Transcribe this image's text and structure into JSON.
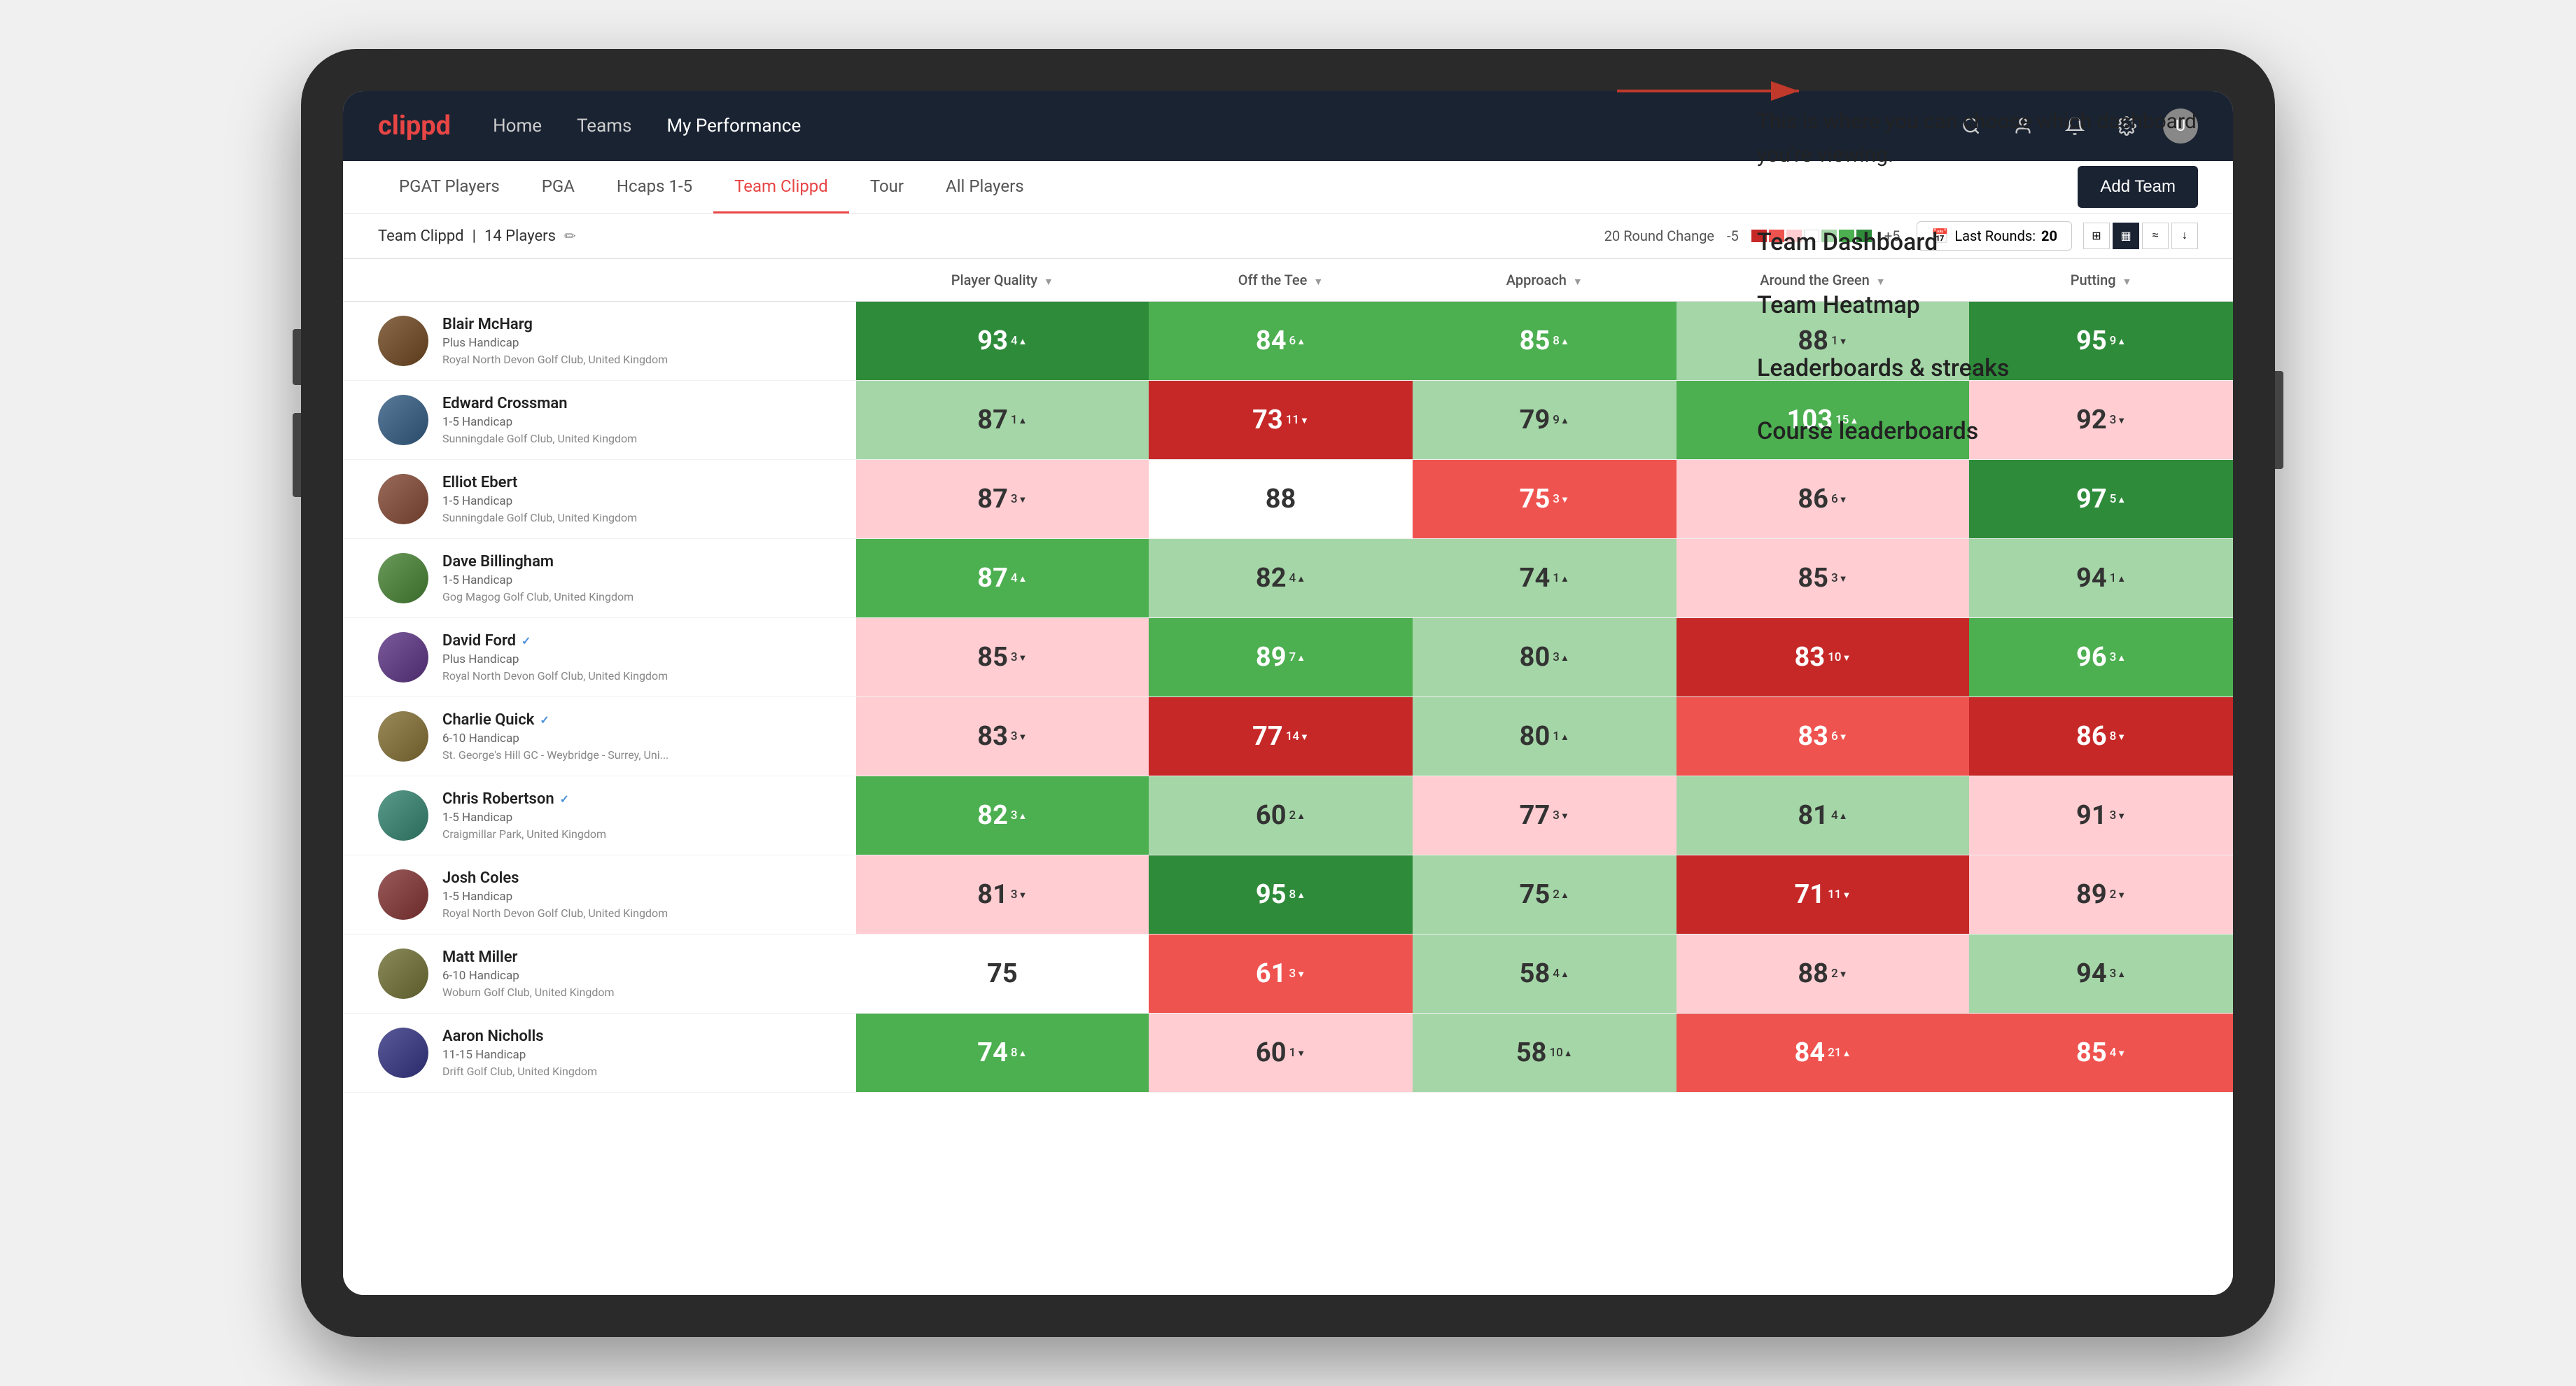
{
  "app": {
    "logo": "clippd",
    "nav": {
      "links": [
        {
          "label": "Home",
          "active": false
        },
        {
          "label": "Teams",
          "active": false
        },
        {
          "label": "My Performance",
          "active": true
        }
      ]
    }
  },
  "subnav": {
    "tabs": [
      {
        "label": "PGAT Players",
        "active": false
      },
      {
        "label": "PGA",
        "active": false
      },
      {
        "label": "Hcaps 1-5",
        "active": false
      },
      {
        "label": "Team Clippd",
        "active": true
      },
      {
        "label": "Tour",
        "active": false
      },
      {
        "label": "All Players",
        "active": false
      }
    ],
    "add_team_label": "Add Team"
  },
  "team_bar": {
    "team_label": "Team Clippd",
    "separator": "|",
    "player_count": "14 Players",
    "round_change_label": "20 Round Change",
    "range_min": "-5",
    "range_max": "+5",
    "last_rounds_label": "Last Rounds:",
    "last_rounds_value": "20"
  },
  "table": {
    "columns": [
      {
        "label": "Player Quality",
        "key": "quality",
        "sortable": true
      },
      {
        "label": "Off the Tee",
        "key": "tee",
        "sortable": true
      },
      {
        "label": "Approach",
        "key": "approach",
        "sortable": true
      },
      {
        "label": "Around the Green",
        "key": "around",
        "sortable": true
      },
      {
        "label": "Putting",
        "key": "putting",
        "sortable": true
      }
    ],
    "players": [
      {
        "name": "Blair McHarg",
        "handicap": "Plus Handicap",
        "club": "Royal North Devon Golf Club, United Kingdom",
        "verified": false,
        "quality": {
          "value": 93,
          "change": "4",
          "dir": "up",
          "bg": "green-dark"
        },
        "tee": {
          "value": 84,
          "change": "6",
          "dir": "up",
          "bg": "green-mid"
        },
        "approach": {
          "value": 85,
          "change": "8",
          "dir": "up",
          "bg": "green-mid"
        },
        "around": {
          "value": 88,
          "change": "1",
          "dir": "down",
          "bg": "green-light"
        },
        "putting": {
          "value": 95,
          "change": "9",
          "dir": "up",
          "bg": "green-dark"
        }
      },
      {
        "name": "Edward Crossman",
        "handicap": "1-5 Handicap",
        "club": "Sunningdale Golf Club, United Kingdom",
        "verified": false,
        "quality": {
          "value": 87,
          "change": "1",
          "dir": "up",
          "bg": "green-light"
        },
        "tee": {
          "value": 73,
          "change": "11",
          "dir": "down",
          "bg": "red-dark"
        },
        "approach": {
          "value": 79,
          "change": "9",
          "dir": "up",
          "bg": "green-light"
        },
        "around": {
          "value": 103,
          "change": "15",
          "dir": "up",
          "bg": "green-mid"
        },
        "putting": {
          "value": 92,
          "change": "3",
          "dir": "down",
          "bg": "red-light"
        }
      },
      {
        "name": "Elliot Ebert",
        "handicap": "1-5 Handicap",
        "club": "Sunningdale Golf Club, United Kingdom",
        "verified": false,
        "quality": {
          "value": 87,
          "change": "3",
          "dir": "down",
          "bg": "red-light"
        },
        "tee": {
          "value": 88,
          "change": "",
          "dir": "none",
          "bg": "white"
        },
        "approach": {
          "value": 75,
          "change": "3",
          "dir": "down",
          "bg": "red-mid"
        },
        "around": {
          "value": 86,
          "change": "6",
          "dir": "down",
          "bg": "red-light"
        },
        "putting": {
          "value": 97,
          "change": "5",
          "dir": "up",
          "bg": "green-dark"
        }
      },
      {
        "name": "Dave Billingham",
        "handicap": "1-5 Handicap",
        "club": "Gog Magog Golf Club, United Kingdom",
        "verified": false,
        "quality": {
          "value": 87,
          "change": "4",
          "dir": "up",
          "bg": "green-mid"
        },
        "tee": {
          "value": 82,
          "change": "4",
          "dir": "up",
          "bg": "green-light"
        },
        "approach": {
          "value": 74,
          "change": "1",
          "dir": "up",
          "bg": "green-light"
        },
        "around": {
          "value": 85,
          "change": "3",
          "dir": "down",
          "bg": "red-light"
        },
        "putting": {
          "value": 94,
          "change": "1",
          "dir": "up",
          "bg": "green-light"
        }
      },
      {
        "name": "David Ford",
        "handicap": "Plus Handicap",
        "club": "Royal North Devon Golf Club, United Kingdom",
        "verified": true,
        "quality": {
          "value": 85,
          "change": "3",
          "dir": "down",
          "bg": "red-light"
        },
        "tee": {
          "value": 89,
          "change": "7",
          "dir": "up",
          "bg": "green-mid"
        },
        "approach": {
          "value": 80,
          "change": "3",
          "dir": "up",
          "bg": "green-light"
        },
        "around": {
          "value": 83,
          "change": "10",
          "dir": "down",
          "bg": "red-dark"
        },
        "putting": {
          "value": 96,
          "change": "3",
          "dir": "up",
          "bg": "green-mid"
        }
      },
      {
        "name": "Charlie Quick",
        "handicap": "6-10 Handicap",
        "club": "St. George's Hill GC - Weybridge - Surrey, Uni...",
        "verified": true,
        "quality": {
          "value": 83,
          "change": "3",
          "dir": "down",
          "bg": "red-light"
        },
        "tee": {
          "value": 77,
          "change": "14",
          "dir": "down",
          "bg": "red-dark"
        },
        "approach": {
          "value": 80,
          "change": "1",
          "dir": "up",
          "bg": "green-light"
        },
        "around": {
          "value": 83,
          "change": "6",
          "dir": "down",
          "bg": "red-mid"
        },
        "putting": {
          "value": 86,
          "change": "8",
          "dir": "down",
          "bg": "red-dark"
        }
      },
      {
        "name": "Chris Robertson",
        "handicap": "1-5 Handicap",
        "club": "Craigmillar Park, United Kingdom",
        "verified": true,
        "quality": {
          "value": 82,
          "change": "3",
          "dir": "up",
          "bg": "green-mid"
        },
        "tee": {
          "value": 60,
          "change": "2",
          "dir": "up",
          "bg": "green-light"
        },
        "approach": {
          "value": 77,
          "change": "3",
          "dir": "down",
          "bg": "red-light"
        },
        "around": {
          "value": 81,
          "change": "4",
          "dir": "up",
          "bg": "green-light"
        },
        "putting": {
          "value": 91,
          "change": "3",
          "dir": "down",
          "bg": "red-light"
        }
      },
      {
        "name": "Josh Coles",
        "handicap": "1-5 Handicap",
        "club": "Royal North Devon Golf Club, United Kingdom",
        "verified": false,
        "quality": {
          "value": 81,
          "change": "3",
          "dir": "down",
          "bg": "red-light"
        },
        "tee": {
          "value": 95,
          "change": "8",
          "dir": "up",
          "bg": "green-dark"
        },
        "approach": {
          "value": 75,
          "change": "2",
          "dir": "up",
          "bg": "green-light"
        },
        "around": {
          "value": 71,
          "change": "11",
          "dir": "down",
          "bg": "red-dark"
        },
        "putting": {
          "value": 89,
          "change": "2",
          "dir": "down",
          "bg": "red-light"
        }
      },
      {
        "name": "Matt Miller",
        "handicap": "6-10 Handicap",
        "club": "Woburn Golf Club, United Kingdom",
        "verified": false,
        "quality": {
          "value": 75,
          "change": "",
          "dir": "none",
          "bg": "white"
        },
        "tee": {
          "value": 61,
          "change": "3",
          "dir": "down",
          "bg": "red-mid"
        },
        "approach": {
          "value": 58,
          "change": "4",
          "dir": "up",
          "bg": "green-light"
        },
        "around": {
          "value": 88,
          "change": "2",
          "dir": "down",
          "bg": "red-light"
        },
        "putting": {
          "value": 94,
          "change": "3",
          "dir": "up",
          "bg": "green-light"
        }
      },
      {
        "name": "Aaron Nicholls",
        "handicap": "11-15 Handicap",
        "club": "Drift Golf Club, United Kingdom",
        "verified": false,
        "quality": {
          "value": 74,
          "change": "8",
          "dir": "up",
          "bg": "green-mid"
        },
        "tee": {
          "value": 60,
          "change": "1",
          "dir": "down",
          "bg": "red-light"
        },
        "approach": {
          "value": 58,
          "change": "10",
          "dir": "up",
          "bg": "green-light"
        },
        "around": {
          "value": 84,
          "change": "21",
          "dir": "up",
          "bg": "red-mid"
        },
        "putting": {
          "value": 85,
          "change": "4",
          "dir": "down",
          "bg": "red-mid"
        }
      }
    ]
  },
  "annotation": {
    "intro": "This is where you can choose which dashboard you're viewing.",
    "items": [
      "Team Dashboard",
      "Team Heatmap",
      "Leaderboards & streaks",
      "Course leaderboards"
    ]
  }
}
